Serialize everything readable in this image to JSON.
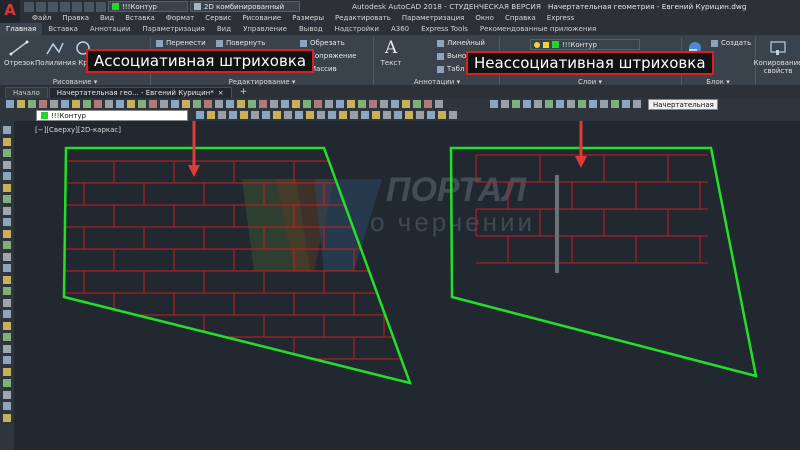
{
  "app": {
    "logo_letter": "A",
    "title": "Autodesk AutoCAD 2018 - СТУДЕНЧЕСКАЯ ВЕРСИЯ",
    "document": "Начертательная геометрия - Евгений Курицин.dwg"
  },
  "quick_access": {
    "layer_value": "!!!Контур",
    "workspace_value": "2D комбинированный"
  },
  "menu": [
    "Файл",
    "Правка",
    "Вид",
    "Вставка",
    "Формат",
    "Сервис",
    "Рисование",
    "Размеры",
    "Редактировать",
    "Параметризация",
    "Окно",
    "Справка",
    "Express"
  ],
  "ribbon_tabs": [
    "Главная",
    "Вставка",
    "Аннотации",
    "Параметризация",
    "Вид",
    "Управление",
    "Вывод",
    "Надстройки",
    "А360",
    "Express Tools",
    "Рекомендованные приложения"
  ],
  "ribbon": {
    "draw": {
      "title": "Рисование",
      "tools": [
        "Отрезок",
        "Полилиния",
        "Кр"
      ]
    },
    "modify": {
      "title": "Редактирование",
      "tools": [
        "Перенести",
        "Повернуть",
        "Обрезать",
        "Сопряжение",
        "Массив"
      ]
    },
    "annotation": {
      "title": "Аннотации",
      "tools": [
        "Текст",
        "Линейный",
        "Выно",
        "Табл"
      ]
    },
    "layers": {
      "title": "Слои",
      "layer_value": "!!!Контур"
    },
    "block": {
      "title": "Блок",
      "tools": [
        "Создать"
      ]
    },
    "properties": {
      "tools": [
        "Копирование свойств"
      ]
    }
  },
  "callouts": {
    "associative": "Ассоциативная штриховка",
    "non_associative": "Неассоциативная штриховка"
  },
  "file_tabs": {
    "start": "Начало",
    "current": "Начертательная гео... - Евгений Курицин*",
    "add": "+"
  },
  "toolbar2": {
    "layer_value": "!!!Контур",
    "style_value": "Начертательная"
  },
  "viewport": {
    "label": "[−][Сверху][2D-каркас]"
  },
  "watermark": {
    "line1": "ПОРТАЛ",
    "line2": "о черчении"
  },
  "colors": {
    "contour": "#22e02a",
    "hatch": "#c81e1e",
    "callout_arrow": "#e03a3a",
    "canvas": "#212830"
  }
}
